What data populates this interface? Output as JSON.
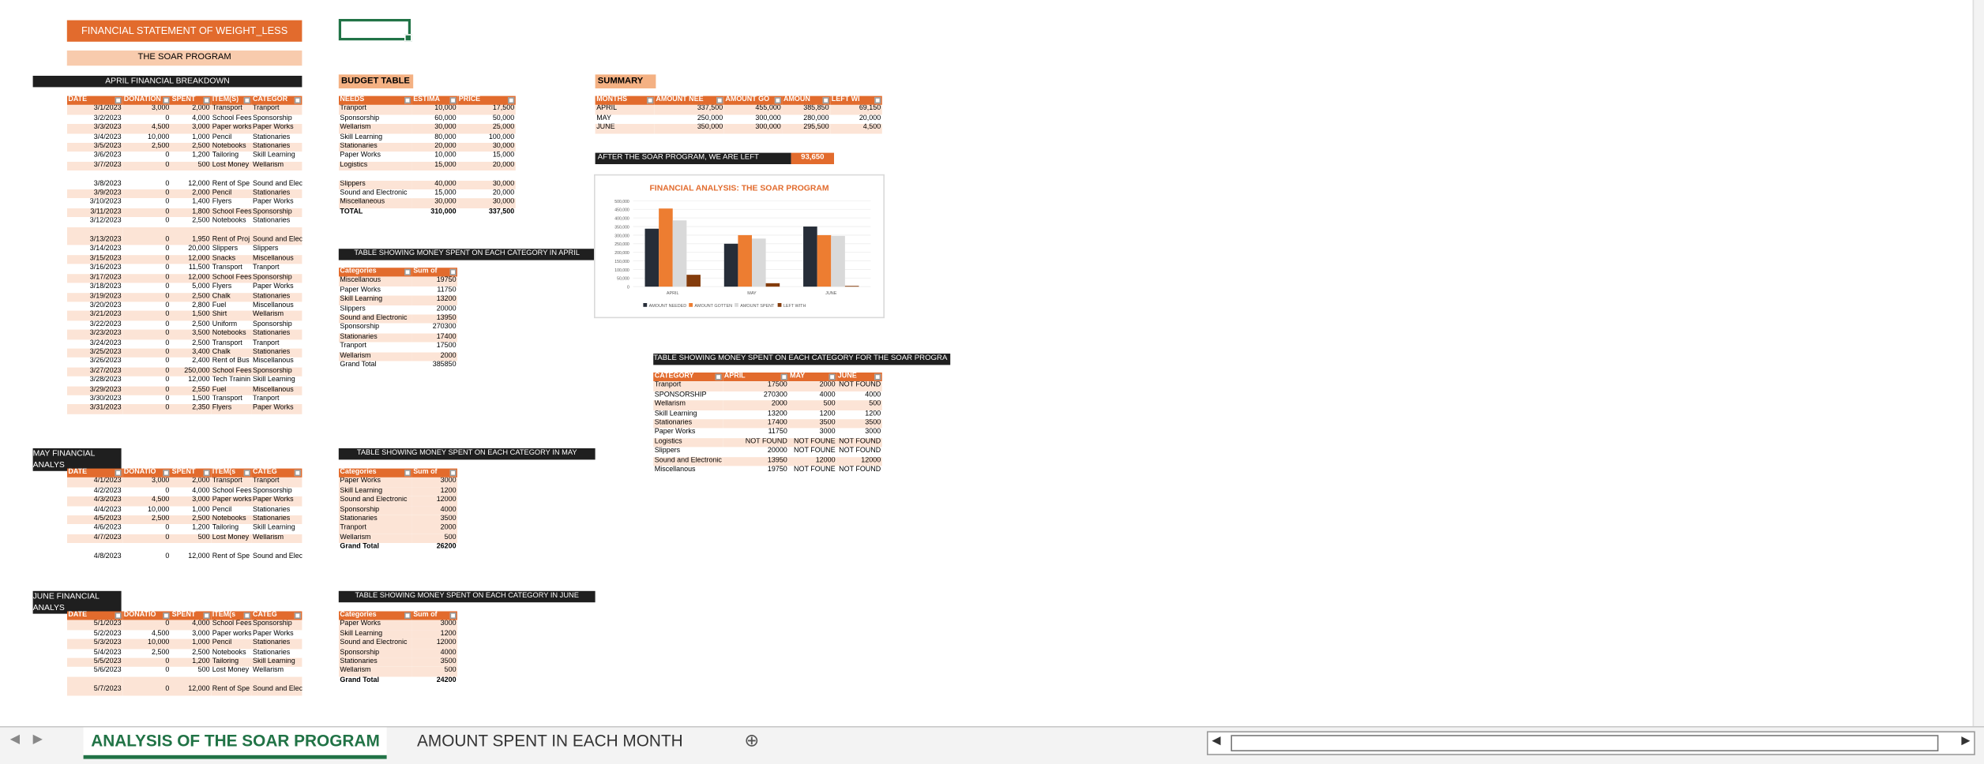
{
  "header": {
    "title": "FINANCIAL STATEMENT OF WEIGHT_LESS",
    "subtitle": "THE SOAR PROGRAM"
  },
  "april": {
    "title": "APRIL FINANCIAL BREAKDOWN",
    "headers": [
      "DATE",
      "DONATION",
      "SPENT",
      "ITEM(S)",
      "CATEGOR"
    ],
    "rows": [
      [
        "3/1/2023",
        "3,000",
        "2,000",
        "Transport",
        "Tranport"
      ],
      [
        "3/2/2023",
        "0",
        "4,000",
        "School Fees",
        "Sponsorship"
      ],
      [
        "3/3/2023",
        "4,500",
        "3,000",
        "Paper works",
        "Paper Works"
      ],
      [
        "3/4/2023",
        "10,000",
        "1,000",
        "Pencil",
        "Stationaries"
      ],
      [
        "3/5/2023",
        "2,500",
        "2,500",
        "Notebooks",
        "Stationaries"
      ],
      [
        "3/6/2023",
        "0",
        "1,200",
        "Tailoring",
        "Skill Learning"
      ],
      [
        "3/7/2023",
        "0",
        "500",
        "Lost Money",
        "Wellarism"
      ],
      [
        "3/8/2023",
        "0",
        "12,000",
        "Rent of Spe",
        "Sound and Electronics"
      ],
      [
        "3/9/2023",
        "0",
        "2,000",
        "Pencil",
        "Stationaries"
      ],
      [
        "3/10/2023",
        "0",
        "1,400",
        "Flyers",
        "Paper Works"
      ],
      [
        "3/11/2023",
        "0",
        "1,800",
        "School Fees",
        "Sponsorship"
      ],
      [
        "3/12/2023",
        "0",
        "2,500",
        "Notebooks",
        "Stationaries"
      ],
      [
        "3/13/2023",
        "0",
        "1,950",
        "Rent of Proj",
        "Sound and Electronics"
      ],
      [
        "3/14/2023",
        "0",
        "20,000",
        "Slippers",
        "Slippers"
      ],
      [
        "3/15/2023",
        "0",
        "12,000",
        "Snacks",
        "Miscellanous"
      ],
      [
        "3/16/2023",
        "0",
        "11,500",
        "Transport",
        "Tranport"
      ],
      [
        "3/17/2023",
        "0",
        "12,000",
        "School Fees",
        "Sponsorship"
      ],
      [
        "3/18/2023",
        "0",
        "5,000",
        "Flyers",
        "Paper Works"
      ],
      [
        "3/19/2023",
        "0",
        "2,500",
        "Chalk",
        "Stationaries"
      ],
      [
        "3/20/2023",
        "0",
        "2,800",
        "Fuel",
        "Miscellanous"
      ],
      [
        "3/21/2023",
        "0",
        "1,500",
        "Shirt",
        "Wellarism"
      ],
      [
        "3/22/2023",
        "0",
        "2,500",
        "Uniform",
        "Sponsorship"
      ],
      [
        "3/23/2023",
        "0",
        "3,500",
        "Notebooks",
        "Stationaries"
      ],
      [
        "3/24/2023",
        "0",
        "2,500",
        "Transport",
        "Tranport"
      ],
      [
        "3/25/2023",
        "0",
        "3,400",
        "Chalk",
        "Stationaries"
      ],
      [
        "3/26/2023",
        "0",
        "2,400",
        "Rent of Bus",
        "Miscellanous"
      ],
      [
        "3/27/2023",
        "0",
        "250,000",
        "School Fees",
        "Sponsorship"
      ],
      [
        "3/28/2023",
        "0",
        "12,000",
        "Tech Trainin",
        "Skill Learning"
      ],
      [
        "3/29/2023",
        "0",
        "2,550",
        "Fuel",
        "Miscellanous"
      ],
      [
        "3/30/2023",
        "0",
        "1,500",
        "Transport",
        "Tranport"
      ],
      [
        "3/31/2023",
        "0",
        "2,350",
        "Flyers",
        "Paper Works"
      ]
    ]
  },
  "may": {
    "title": "MAY FINANCIAL ANALYS",
    "headers": [
      "DATE",
      "DONATIO",
      "SPENT",
      "ITEM(s",
      "CATEG"
    ],
    "rows": [
      [
        "4/1/2023",
        "3,000",
        "2,000",
        "Transport",
        "Tranport"
      ],
      [
        "4/2/2023",
        "0",
        "4,000",
        "School Fees",
        "Sponsorship"
      ],
      [
        "4/3/2023",
        "4,500",
        "3,000",
        "Paper works",
        "Paper Works"
      ],
      [
        "4/4/2023",
        "10,000",
        "1,000",
        "Pencil",
        "Stationaries"
      ],
      [
        "4/5/2023",
        "2,500",
        "2,500",
        "Notebooks",
        "Stationaries"
      ],
      [
        "4/6/2023",
        "0",
        "1,200",
        "Tailoring",
        "Skill Learning"
      ],
      [
        "4/7/2023",
        "0",
        "500",
        "Lost Money",
        "Wellarism"
      ],
      [
        "4/8/2023",
        "0",
        "12,000",
        "Rent of Spe",
        "Sound and Electronics"
      ]
    ]
  },
  "june": {
    "title": "JUNE FINANCIAL ANALYS",
    "headers": [
      "DATE",
      "DONATIO",
      "SPENT",
      "ITEM(s",
      "CATEG"
    ],
    "rows": [
      [
        "5/1/2023",
        "0",
        "4,000",
        "School Fees",
        "Sponsorship"
      ],
      [
        "5/2/2023",
        "4,500",
        "3,000",
        "Paper works",
        "Paper Works"
      ],
      [
        "5/3/2023",
        "10,000",
        "1,000",
        "Pencil",
        "Stationaries"
      ],
      [
        "5/4/2023",
        "2,500",
        "2,500",
        "Notebooks",
        "Stationaries"
      ],
      [
        "5/5/2023",
        "0",
        "1,200",
        "Tailoring",
        "Skill Learning"
      ],
      [
        "5/6/2023",
        "0",
        "500",
        "Lost Money",
        "Wellarism"
      ],
      [
        "5/7/2023",
        "0",
        "12,000",
        "Rent of Spe",
        "Sound and Electronics"
      ]
    ]
  },
  "budget": {
    "title": "BUDGET TABLE",
    "headers": [
      "NEEDS",
      "ESTIMA",
      "PRICE"
    ],
    "rows": [
      [
        "Tranport",
        "10,000",
        "17,500"
      ],
      [
        "Sponsorship",
        "60,000",
        "50,000"
      ],
      [
        "Wellarism",
        "30,000",
        "25,000"
      ],
      [
        "Skill Learning",
        "80,000",
        "100,000"
      ],
      [
        "Stationaries",
        "20,000",
        "30,000"
      ],
      [
        "Paper Works",
        "10,000",
        "15,000"
      ],
      [
        "Logistics",
        "15,000",
        "20,000"
      ],
      [
        "",
        "",
        " "
      ],
      [
        "Slippers",
        "40,000",
        "30,000"
      ],
      [
        "Sound and Electronic",
        "15,000",
        "20,000"
      ],
      [
        "Miscellaneous",
        "30,000",
        "30,000"
      ],
      [
        "TOTAL",
        "310,000",
        "337,500"
      ]
    ]
  },
  "summary": {
    "title": "SUMMARY",
    "headers": [
      "MONTHS",
      "AMOUNT NEE",
      "AMOUNT GO",
      "AMOUN",
      "LEFT WI"
    ],
    "rows": [
      [
        "APRIL",
        "337,500",
        "455,000",
        "385,850",
        "69,150"
      ],
      [
        "MAY",
        "250,000",
        "300,000",
        "280,000",
        "20,000"
      ],
      [
        "JUNE",
        "350,000",
        "300,000",
        "295,500",
        "4,500"
      ]
    ],
    "left_label": "AFTER THE SOAR PROGRAM, WE ARE LEFT",
    "left_value": "93,650"
  },
  "pivot_april": {
    "title": "TABLE SHOWING MONEY SPENT ON EACH CATEGORY IN APRIL",
    "headers": [
      "Categories",
      "Sum of"
    ],
    "rows": [
      [
        "Miscellanous",
        "19750"
      ],
      [
        "Paper Works",
        "11750"
      ],
      [
        "Skill Learning",
        "13200"
      ],
      [
        "Slippers",
        "20000"
      ],
      [
        "Sound and Electronic",
        "13950"
      ],
      [
        "Sponsorship",
        "270300"
      ],
      [
        "Stationaries",
        "17400"
      ],
      [
        "Tranport",
        "17500"
      ],
      [
        "Wellarism",
        "2000"
      ],
      [
        "Grand Total",
        "385850"
      ]
    ]
  },
  "pivot_may": {
    "title": "TABLE SHOWING MONEY SPENT ON EACH CATEGORY IN MAY",
    "headers": [
      "Categories",
      "Sum of"
    ],
    "rows": [
      [
        "Paper Works",
        "3000"
      ],
      [
        "Skill Learning",
        "1200"
      ],
      [
        "Sound and Electronic",
        "12000"
      ],
      [
        "Sponsorship",
        "4000"
      ],
      [
        "Stationaries",
        "3500"
      ],
      [
        "Tranport",
        "2000"
      ],
      [
        "Wellarism",
        "500"
      ]
    ],
    "total": [
      "Grand Total",
      "26200"
    ]
  },
  "pivot_june": {
    "title": "TABLE SHOWING MONEY SPENT ON EACH CATEGORY IN JUNE",
    "headers": [
      "Categories",
      "Sum of"
    ],
    "rows": [
      [
        "Paper Works",
        "3000"
      ],
      [
        "Skill Learning",
        "1200"
      ],
      [
        "Sound and Electronic",
        "12000"
      ],
      [
        "Sponsorship",
        "4000"
      ],
      [
        "Stationaries",
        "3500"
      ],
      [
        "Wellarism",
        "500"
      ]
    ],
    "total": [
      "Grand Total",
      "24200"
    ]
  },
  "category_table": {
    "title": "TABLE SHOWING MONEY SPENT ON EACH CATEGORY FOR THE SOAR PROGRA",
    "headers": [
      "CATEGORY",
      "APRIL",
      "MAY",
      "JUNE"
    ],
    "rows": [
      [
        "Tranport",
        "17500",
        "2000",
        "NOT FOUND"
      ],
      [
        "SPONSORSHIP",
        "270300",
        "4000",
        "4000"
      ],
      [
        "Wellarism",
        "2000",
        "500",
        "500"
      ],
      [
        "Skill Learning",
        "13200",
        "1200",
        "1200"
      ],
      [
        "Stationaries",
        "17400",
        "3500",
        "3500"
      ],
      [
        "Paper Works",
        "11750",
        "3000",
        "3000"
      ],
      [
        "Logistics",
        "NOT FOUND",
        "NOT FOUNE",
        "NOT FOUND"
      ],
      [
        "Slippers",
        "20000",
        "NOT FOUNE",
        "NOT FOUND"
      ],
      [
        "Sound and Electronic",
        "13950",
        "12000",
        "12000"
      ],
      [
        "Miscellanous",
        "19750",
        "NOT FOUNE",
        "NOT FOUND"
      ]
    ]
  },
  "chart_data": {
    "type": "bar",
    "title": "FINANCIAL ANALYSIS: THE SOAR PROGRAM",
    "categories": [
      "APRIL",
      "MAY",
      "JUNE"
    ],
    "series": [
      {
        "name": "AMOUNT NEEDED",
        "values": [
          337500,
          250000,
          350000
        ],
        "color": "#262d38"
      },
      {
        "name": "AMOUNT GOTTEN",
        "values": [
          455000,
          300000,
          300000
        ],
        "color": "#ed7d31"
      },
      {
        "name": "AMOUNT SPENT",
        "values": [
          385850,
          280000,
          295500
        ],
        "color": "#d9d9d9"
      },
      {
        "name": "LEFT WITH",
        "values": [
          69150,
          20000,
          4500
        ],
        "color": "#843c0c"
      }
    ],
    "ylim": [
      0,
      500000
    ],
    "yticks": [
      "0",
      "50,000",
      "100,000",
      "150,000",
      "200,000",
      "250,000",
      "300,000",
      "350,000",
      "400,000",
      "450,000",
      "500,000"
    ],
    "legend": "bottom"
  },
  "tabs": [
    {
      "label": "ANALYSIS OF THE SOAR PROGRAM"
    },
    {
      "label": "AMOUNT SPENT IN EACH MONTH"
    }
  ],
  "tabs_add": "⊕"
}
